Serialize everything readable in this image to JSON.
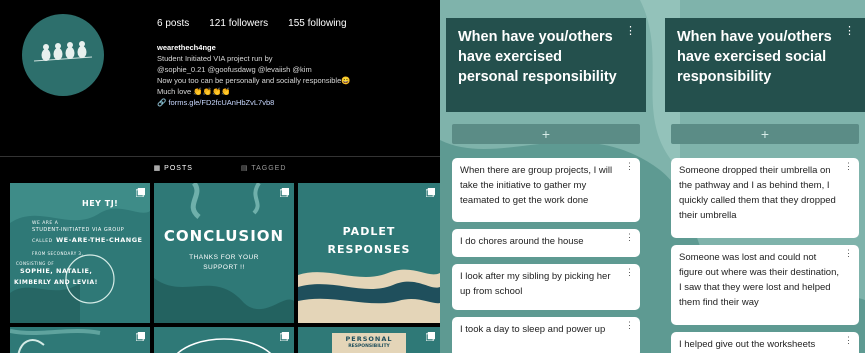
{
  "instagram": {
    "stats": {
      "posts": "6 posts",
      "followers": "121 followers",
      "following": "155 following"
    },
    "bio": {
      "username": "wearethech4nge",
      "lines": [
        "Student Initiated VIA project run by",
        "@sophie_0.21 @goofusdawg @levaiish @kim",
        "Now you too can be personally and socially responsible😀",
        "Much love 👏👏👏👏"
      ],
      "link": "forms.gle/FD2fcUAnHbZvL7vb8"
    },
    "tabs": {
      "posts": "POSTS",
      "tagged": "TAGGED"
    },
    "posts": {
      "p1": {
        "title": "HEY TJ!",
        "l1": "WE ARE A",
        "l2": "STUDENT-INITIATED VIA GROUP",
        "l3": "CALLED",
        "l4": "WE-ARE-THE-CHANGE",
        "l5": "FROM SECONDARY 3,",
        "l6": "CONSISTING OF",
        "l7": "SOPHIE, NATALIE,",
        "l8": "KIMBERLY AND LEVIA!"
      },
      "p2": {
        "title": "CONCLUSION",
        "sub1": "THANKS FOR YOUR",
        "sub2": "SUPPORT !!"
      },
      "p3": {
        "title1": "PADLET",
        "title2": "RESPONSES"
      },
      "p6": {
        "title1": "PERSONAL",
        "title2": "RESPONSIBILITY"
      }
    }
  },
  "padlet": {
    "columns": [
      {
        "title": "When have you/others have exercised personal responsibility",
        "add_label": "+",
        "cards": [
          "When there are group projects, I will take the initiative to gather my teamated to get the work done",
          "I do chores around the house",
          "I look after my sibling by picking her up from school",
          "I took a day to sleep and power up"
        ]
      },
      {
        "title": "When have you/others have exercised social responsibility",
        "add_label": "+",
        "cards": [
          "Someone dropped their umbrella on the pathway and I as behind them, I quickly called them that they dropped their umbrella",
          "Someone was lost and could not figure out where was their destination, I saw that they were lost and helped them find their way",
          "I helped give out the worksheets"
        ]
      }
    ]
  },
  "colors": {
    "teal": "#2f7977",
    "padlet_bg": "#7fb3ab",
    "header": "#24504d",
    "add_bar": "#5b8c86"
  }
}
